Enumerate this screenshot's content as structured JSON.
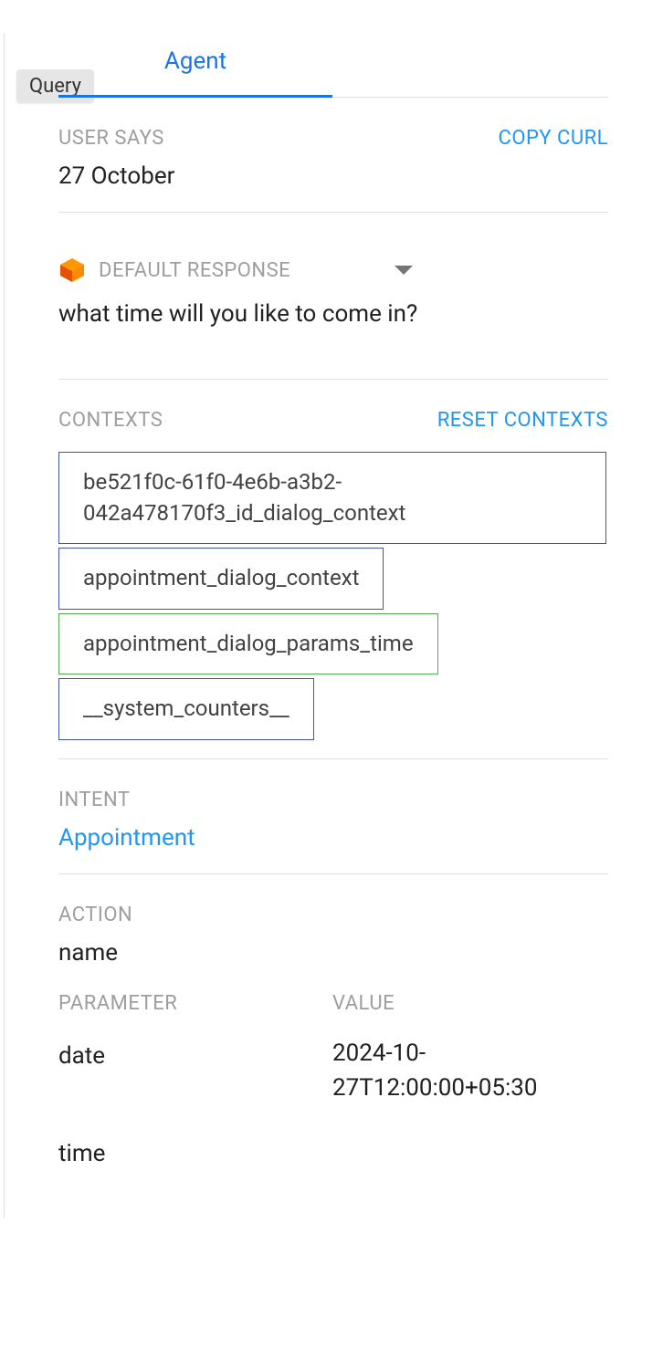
{
  "badge": {
    "label": "Query"
  },
  "tabs": {
    "agent_label": "Agent"
  },
  "user_says": {
    "label": "USER SAYS",
    "copy_curl": "COPY CURL",
    "value": "27 October"
  },
  "response": {
    "label": "DEFAULT RESPONSE",
    "text": "what time will you like to come in?"
  },
  "contexts": {
    "label": "CONTEXTS",
    "reset": "RESET CONTEXTS",
    "items": [
      "be521f0c-61f0-4e6b-a3b2-042a478170f3_id_dialog_context",
      "appointment_dialog_context",
      "appointment_dialog_params_time",
      "__system_counters__"
    ]
  },
  "intent": {
    "label": "INTENT",
    "value": "Appointment"
  },
  "action": {
    "label": "ACTION",
    "value": "name"
  },
  "params": {
    "name_header": "PARAMETER",
    "value_header": "VALUE",
    "rows": [
      {
        "name": "date",
        "value": "2024-10-27T12:00:00+05:30"
      },
      {
        "name": "time",
        "value": ""
      }
    ]
  }
}
